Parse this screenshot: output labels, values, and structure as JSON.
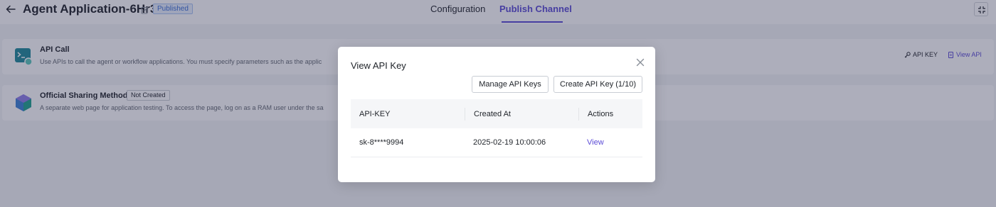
{
  "header": {
    "title": "Agent Application-6Hr3",
    "status_badge": "Published",
    "tabs": [
      {
        "label": "Configuration",
        "active": false
      },
      {
        "label": "Publish Channel",
        "active": true
      }
    ]
  },
  "channels": [
    {
      "title": "API Call",
      "description": "Use APIs to call the agent or workflow applications. You must specify parameters such as the applic",
      "icon": "terminal-icon",
      "links": {
        "api_key": "API KEY",
        "view_api": "View API"
      }
    },
    {
      "title": "Official Sharing Method",
      "badge": "Not Created",
      "description": "A separate web page for application testing. To access the page, log on as a RAM user under the sa",
      "icon": "cube-logo-icon"
    }
  ],
  "modal": {
    "title": "View API Key",
    "buttons": {
      "manage": "Manage API Keys",
      "create": "Create API Key (1/10)"
    },
    "table": {
      "headers": [
        "API-KEY",
        "Created At",
        "Actions"
      ],
      "rows": [
        {
          "key": "sk-8****9994",
          "created_at": "2025-02-19 10:00:06",
          "action": "View"
        }
      ]
    }
  },
  "colors": {
    "accent": "#5b4bd6",
    "badge_blue": "#3b6fd6",
    "overlay": "rgba(40,42,75,0.38)"
  }
}
